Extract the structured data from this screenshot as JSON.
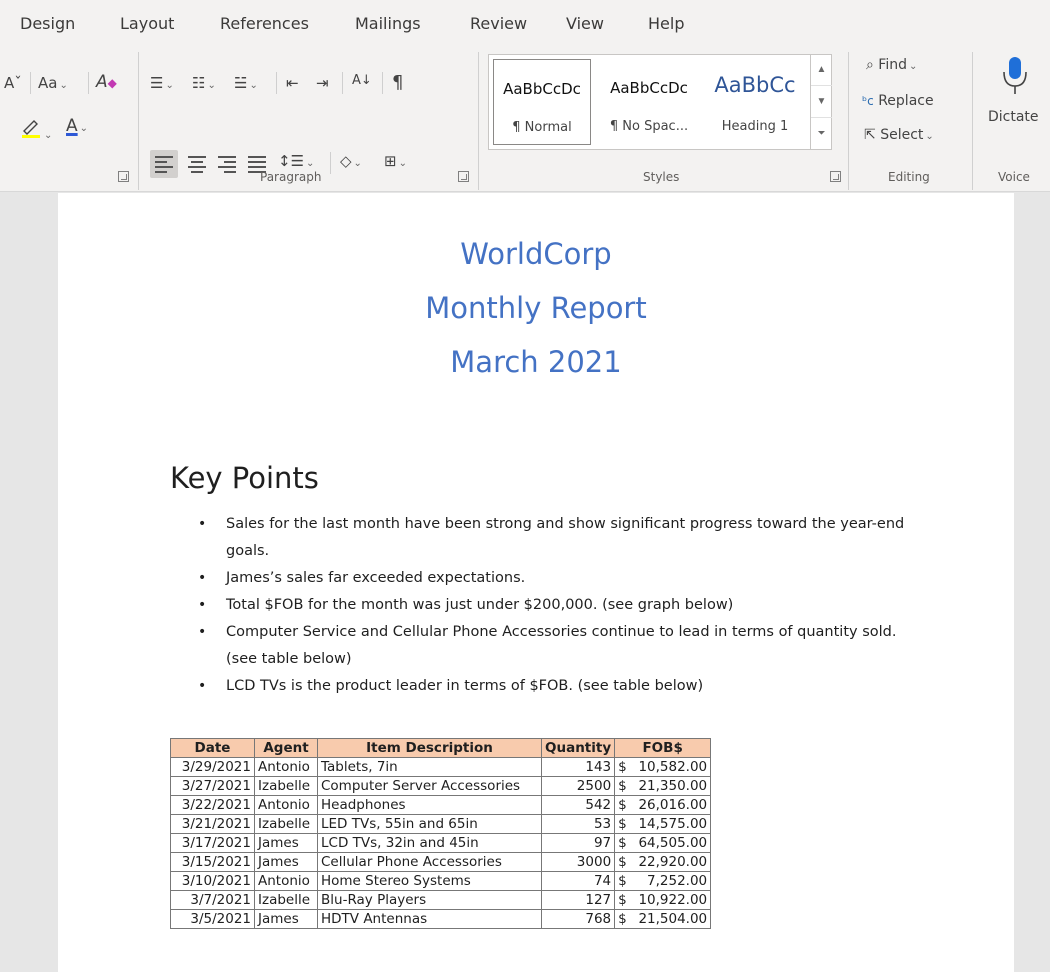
{
  "menu": [
    "Design",
    "Layout",
    "References",
    "Mailings",
    "Review",
    "View",
    "Help"
  ],
  "ribbon": {
    "font": {
      "change_case": "Aa",
      "clear_format": "A",
      "font_color_letter": "A"
    },
    "groups": {
      "paragraph": "Paragraph",
      "styles": "Styles",
      "editing": "Editing",
      "voice": "Voice"
    },
    "styles": [
      {
        "sample": "AaBbCcDc",
        "name": "¶ Normal",
        "selected": true
      },
      {
        "sample": "AaBbCcDc",
        "name": "¶ No Spac...",
        "selected": false
      },
      {
        "sample": "AaBbCc",
        "name": "Heading 1",
        "selected": false
      }
    ],
    "editing": {
      "find": "Find",
      "replace": "Replace",
      "select": "Select"
    },
    "voice": {
      "dictate": "Dictate"
    },
    "colors": {
      "highlight": "#ffff00",
      "font_color": "#2e59d6",
      "heading_sample": "#2f5597"
    }
  },
  "document": {
    "title_lines": [
      "WorldCorp",
      "Monthly Report",
      "March 2021"
    ],
    "heading": "Key Points",
    "bullets": [
      "Sales for the last month have been strong and show significant progress toward the year-end goals.",
      "James’s  sales far exceeded expectations.",
      "Total $FOB for the month was just under $200,000. (see graph below)",
      "Computer Service and Cellular Phone Accessories continue to lead in terms of quantity sold. (see table below)",
      "LCD TVs is the product leader in terms of $FOB. (see table below)"
    ],
    "table": {
      "headers": [
        "Date",
        "Agent",
        "Item Description",
        "Quantity",
        "FOB$"
      ],
      "rows": [
        [
          "3/29/2021",
          "Antonio",
          "Tablets, 7in",
          "143",
          "10,582.00"
        ],
        [
          "3/27/2021",
          "Izabelle",
          "Computer Server Accessories",
          "2500",
          "21,350.00"
        ],
        [
          "3/22/2021",
          "Antonio",
          "Headphones",
          "542",
          "26,016.00"
        ],
        [
          "3/21/2021",
          "Izabelle",
          "LED TVs, 55in and 65in",
          "53",
          "14,575.00"
        ],
        [
          "3/17/2021",
          "James",
          "LCD TVs, 32in and 45in",
          "97",
          "64,505.00"
        ],
        [
          "3/15/2021",
          "James",
          "Cellular Phone Accessories",
          "3000",
          "22,920.00"
        ],
        [
          "3/10/2021",
          "Antonio",
          "Home Stereo Systems",
          "74",
          "7,252.00"
        ],
        [
          "3/7/2021",
          "Izabelle",
          "Blu-Ray Players",
          "127",
          "10,922.00"
        ],
        [
          "3/5/2021",
          "James",
          "HDTV Antennas",
          "768",
          "21,504.00"
        ]
      ],
      "currency_symbol": "$",
      "header_color": "#f8cbad"
    },
    "title_color": "#4472c4"
  }
}
